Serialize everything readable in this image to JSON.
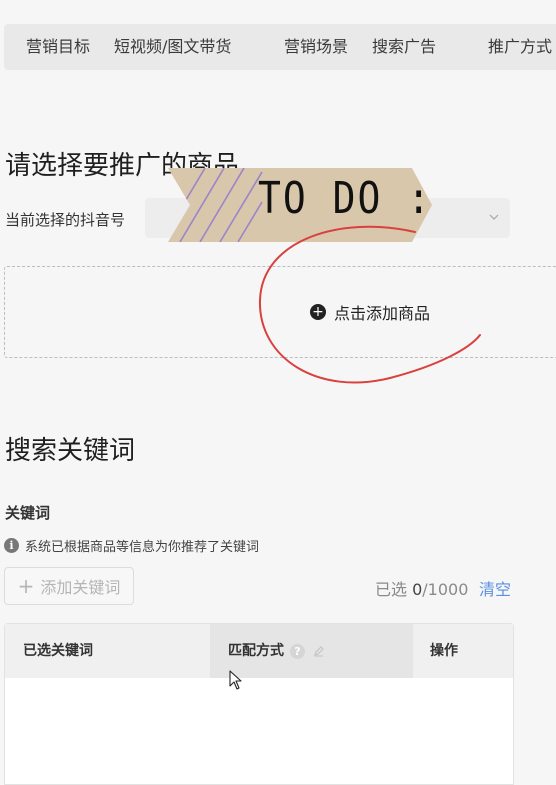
{
  "tabs": [
    {
      "label": "营销目标"
    },
    {
      "label": "短视频/图文带货"
    },
    {
      "label": "营销场景"
    },
    {
      "label": "搜索广告"
    },
    {
      "label": "推广方式"
    }
  ],
  "product_section": {
    "title": "请选择要推广的商品",
    "account_label": "当前选择的抖音号",
    "account_value": "",
    "add_product_label": "点击添加商品"
  },
  "keyword_section": {
    "title": "搜索关键词",
    "keywords_label": "关键词",
    "hint": "系统已根据商品等信息为你推荐了关键词",
    "add_keyword_label": "添加关键词",
    "selected_prefix": "已选 ",
    "selected_count": "0",
    "selected_max": "/1000",
    "clear_label": "清空",
    "table_headers": [
      "已选关键词",
      "匹配方式",
      "操作"
    ]
  },
  "annotation": {
    "sticker_text": "TO DO :"
  },
  "colors": {
    "accent_link": "#5b8fe0",
    "annotation_red": "#d9413f",
    "sticker_tan": "#d8c7ab"
  },
  "icons": [
    "chevron-down-icon",
    "plus-circle-icon",
    "info-icon",
    "plus-icon",
    "question-icon",
    "edit-icon",
    "mouse-cursor-icon"
  ]
}
